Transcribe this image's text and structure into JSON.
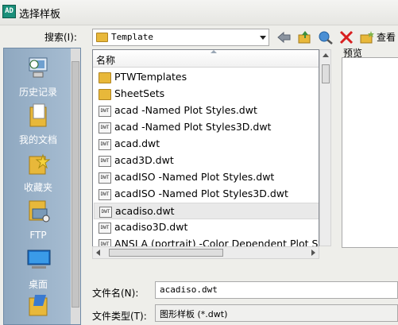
{
  "window": {
    "title": "选择样板",
    "icon_text": "AD"
  },
  "toolbar": {
    "lookin_label": "搜索(I):",
    "lookin_value": "Template",
    "view_label": "查看"
  },
  "places": [
    {
      "label": "历史记录"
    },
    {
      "label": "我的文档"
    },
    {
      "label": "收藏夹"
    },
    {
      "label": "FTP"
    },
    {
      "label": "桌面"
    }
  ],
  "list": {
    "column_name": "名称",
    "items": [
      {
        "name": "PTWTemplates",
        "type": "folder"
      },
      {
        "name": "SheetSets",
        "type": "folder"
      },
      {
        "name": "acad -Named Plot Styles.dwt",
        "type": "dwt"
      },
      {
        "name": "acad -Named Plot Styles3D.dwt",
        "type": "dwt"
      },
      {
        "name": "acad.dwt",
        "type": "dwt"
      },
      {
        "name": "acad3D.dwt",
        "type": "dwt"
      },
      {
        "name": "acadISO -Named Plot Styles.dwt",
        "type": "dwt"
      },
      {
        "name": "acadISO -Named Plot Styles3D.dwt",
        "type": "dwt"
      },
      {
        "name": "acadiso.dwt",
        "type": "dwt",
        "selected": true
      },
      {
        "name": "acadiso3D.dwt",
        "type": "dwt"
      },
      {
        "name": "ANSI A (portrait) -Color Dependent Plot Styles.dwt",
        "type": "dwt"
      }
    ]
  },
  "preview": {
    "label": "预览"
  },
  "filename": {
    "label": "文件名(N):",
    "value": "acadiso.dwt"
  },
  "filetype": {
    "label": "文件类型(T):",
    "value": "图形样板 (*.dwt)"
  }
}
